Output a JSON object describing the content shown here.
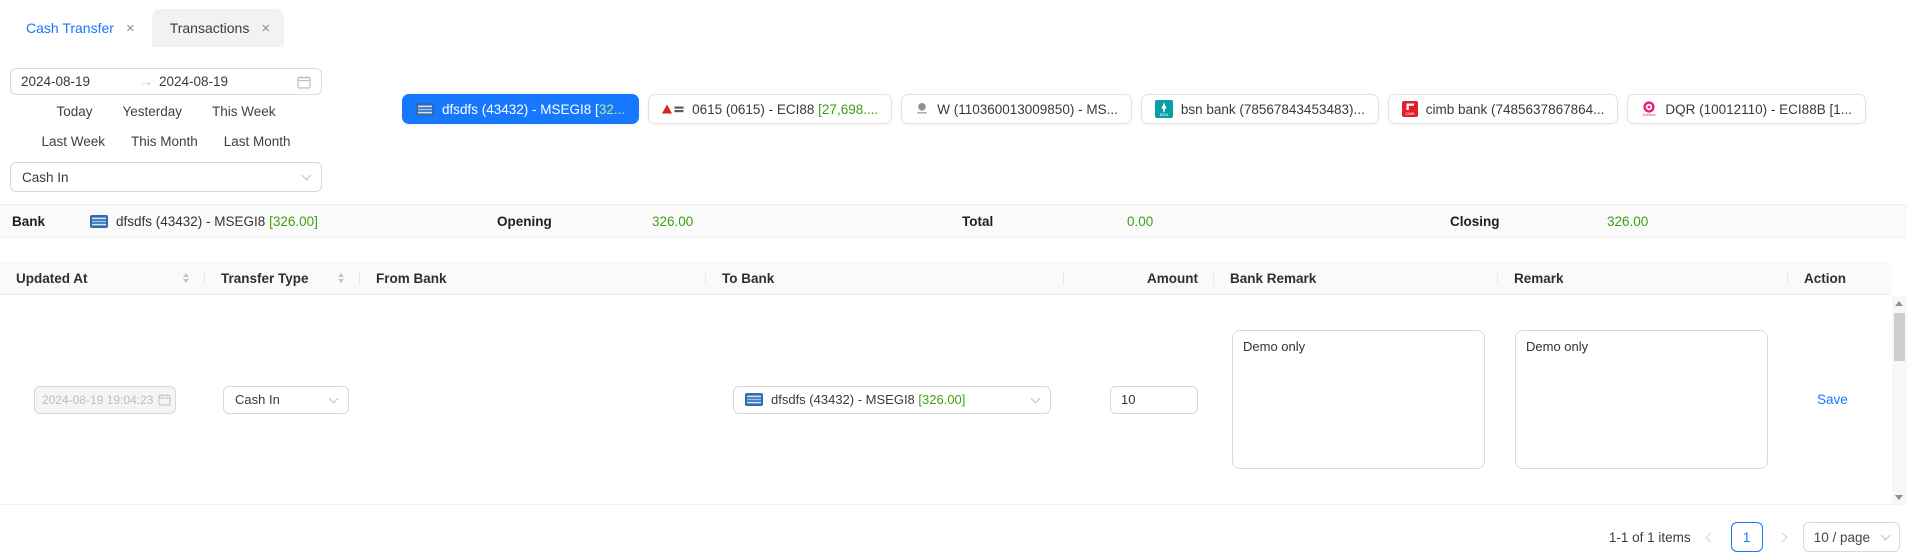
{
  "colors": {
    "accent": "#1677ff",
    "green": "#3fa013",
    "green_on_selected": "#b7eb8f",
    "selected_bank_bg": "#1677ff"
  },
  "icons": {
    "close": "×",
    "range_arrow": "→"
  },
  "tabs": [
    {
      "label": "Cash Transfer",
      "active": true
    },
    {
      "label": "Transactions",
      "active": false
    }
  ],
  "date_filter": {
    "start": "2024-08-19",
    "end": "2024-08-19"
  },
  "quick_links": {
    "today": "Today",
    "yesterday": "Yesterday",
    "this_week": "This Week",
    "last_week": "Last Week",
    "this_month": "This Month",
    "last_month": "Last Month"
  },
  "type_filter": {
    "value": "Cash In"
  },
  "bank_tabs": [
    {
      "name": "dfsdfs (43432) - MSEGI8 [",
      "green": "32...",
      "selected": true
    },
    {
      "name": "0615 (0615) - ECI88 ",
      "green": "[27,698....",
      "selected": false
    },
    {
      "name": "W (110360013009850) - MS...",
      "green": "",
      "selected": false
    },
    {
      "name": "bsn bank (78567843453483)...",
      "green": "",
      "selected": false
    },
    {
      "name": "cimb bank (7485637867864...",
      "green": "",
      "selected": false
    },
    {
      "name": "DQR (10012110) - ECI88B [1...",
      "green": "",
      "selected": false
    }
  ],
  "summary": {
    "bank_label": "Bank",
    "bank_name": "dfsdfs (43432) - MSEGI8 ",
    "bank_balance": "[326.00]",
    "opening_label": "Opening",
    "opening_value": "326.00",
    "total_label": "Total",
    "total_value": "0.00",
    "closing_label": "Closing",
    "closing_value": "326.00"
  },
  "table": {
    "headers": {
      "updated_at": "Updated At",
      "transfer_type": "Transfer Type",
      "from_bank": "From Bank",
      "to_bank": "To Bank",
      "amount": "Amount",
      "bank_remark": "Bank Remark",
      "remark": "Remark",
      "action": "Action"
    },
    "row": {
      "updated_at": "2024-08-19 19:04:23",
      "transfer_type": "Cash In",
      "from_bank": "",
      "to_bank": "dfsdfs (43432) - MSEGI8 ",
      "to_bank_balance": "[326.00]",
      "amount": "10",
      "bank_remark": "Demo only",
      "remark": "Demo only",
      "save_label": "Save"
    }
  },
  "pagination": {
    "total_text": "1-1 of 1 items",
    "page": "1",
    "page_size": "10 / page"
  }
}
